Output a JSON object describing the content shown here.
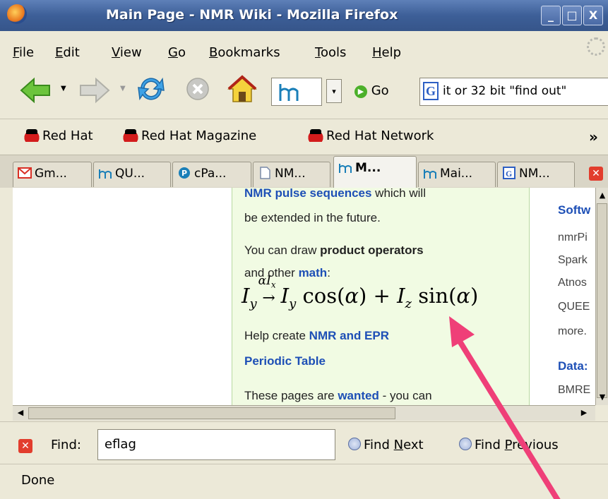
{
  "window": {
    "title": "Main Page - NMR Wiki - Mozilla Firefox",
    "controls": {
      "minimize": "_",
      "maximize": "□",
      "close": "X"
    }
  },
  "menu": {
    "items": [
      {
        "label": "File",
        "key": "F"
      },
      {
        "label": "Edit",
        "key": "E"
      },
      {
        "label": "View",
        "key": "V"
      },
      {
        "label": "Go",
        "key": "G"
      },
      {
        "label": "Bookmarks",
        "key": "B"
      },
      {
        "label": "Tools",
        "key": "T"
      },
      {
        "label": "Help",
        "key": "H"
      }
    ]
  },
  "navbar": {
    "go_label": "Go",
    "search_text": "it or 32 bit \"find out\"",
    "dropdown_glyph": "▾"
  },
  "bookmarks": {
    "items": [
      "Red Hat",
      "Red Hat Magazine",
      "Red Hat Network"
    ],
    "overflow": "»"
  },
  "tabs": [
    {
      "label": "Gm...",
      "icon": "gmail-icon",
      "color": "#d93025"
    },
    {
      "label": "QU...",
      "icon": "nmrwiki-icon",
      "color": "#1a7fb8"
    },
    {
      "label": "cPa...",
      "icon": "cpanel-icon",
      "color": "#1a7fb8"
    },
    {
      "label": "NM...",
      "icon": "page-icon",
      "color": "#7a8aa8"
    },
    {
      "label": "M...",
      "icon": "nmrwiki-icon",
      "color": "#1a7fb8",
      "active": true
    },
    {
      "label": "Mai...",
      "icon": "nmrwiki-icon",
      "color": "#1a7fb8"
    },
    {
      "label": "NM...",
      "icon": "google-icon",
      "color": "#2d5fc4"
    }
  ],
  "content": {
    "line1_link": "NMR pulse sequences",
    "line1_rest": " which will",
    "line2": "be extended in the future.",
    "line3_pre": "You can draw ",
    "line3_bold": "product operators",
    "line4_pre": "and other ",
    "line4_link": "math",
    "line4_post": ":",
    "math_formula": "Iy —αIx→ Iy cos(α) + Iz sin(α)",
    "line5_pre": "Help create ",
    "line5_link": "NMR and EPR",
    "line6_link": "Periodic Table",
    "line7_pre": "These pages are ",
    "line7_link": "wanted",
    "line7_post": " - you can"
  },
  "right_column": {
    "heading1": "Softw",
    "items": [
      "nmrPi",
      "Spark",
      "Atnos",
      "QUEE",
      "more."
    ],
    "heading2": "Data:",
    "item_last": "BMRE"
  },
  "findbar": {
    "label": "Find:",
    "value": "eflag",
    "next_label": "Find Next",
    "next_key": "N",
    "prev_label": "Find Previous",
    "prev_key": "P"
  },
  "status": {
    "text": "Done"
  },
  "colors": {
    "annotation_arrow": "#ef3f78",
    "link": "#1d4fb6",
    "green_box": "#f1fbe3"
  }
}
